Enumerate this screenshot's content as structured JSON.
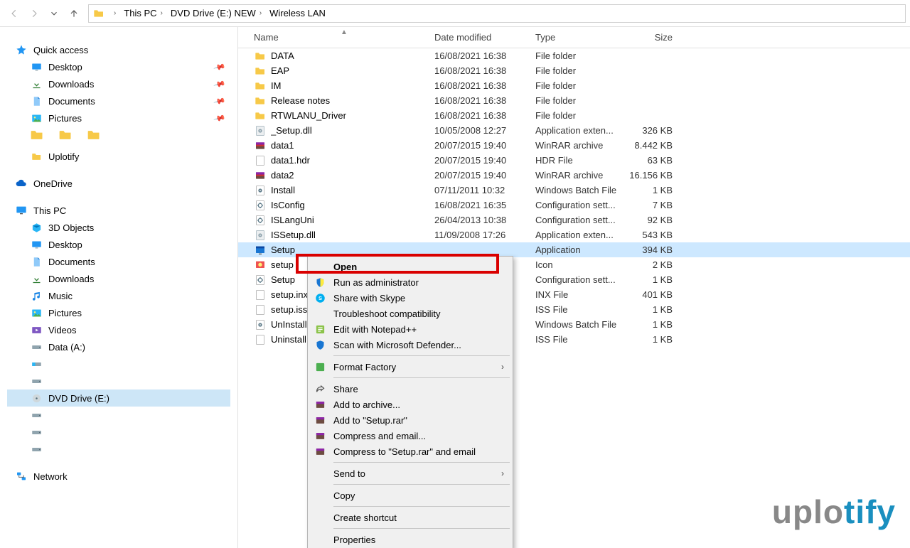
{
  "toolbar": {
    "breadcrumb": [
      "This PC",
      "DVD Drive (E:) NEW",
      "Wireless LAN"
    ]
  },
  "columns": {
    "name": "Name",
    "date": "Date modified",
    "type": "Type",
    "size": "Size"
  },
  "sidebar": {
    "quick_access": "Quick access",
    "desktop": "Desktop",
    "downloads": "Downloads",
    "documents": "Documents",
    "pictures": "Pictures",
    "uplotify": "Uplotify",
    "onedrive": "OneDrive",
    "this_pc": "This PC",
    "objects3d": "3D Objects",
    "desktop2": "Desktop",
    "documents2": "Documents",
    "downloads2": "Downloads",
    "music": "Music",
    "pictures2": "Pictures",
    "videos": "Videos",
    "data_a": "Data (A:)",
    "dvd_drive": "DVD Drive (E:)",
    "network": "Network"
  },
  "files": [
    {
      "icon": "folder",
      "name": "DATA",
      "date": "16/08/2021 16:38",
      "type": "File folder",
      "size": ""
    },
    {
      "icon": "folder",
      "name": "EAP",
      "date": "16/08/2021 16:38",
      "type": "File folder",
      "size": ""
    },
    {
      "icon": "folder",
      "name": "IM",
      "date": "16/08/2021 16:38",
      "type": "File folder",
      "size": ""
    },
    {
      "icon": "folder",
      "name": "Release notes",
      "date": "16/08/2021 16:38",
      "type": "File folder",
      "size": ""
    },
    {
      "icon": "folder",
      "name": "RTWLANU_Driver",
      "date": "16/08/2021 16:38",
      "type": "File folder",
      "size": ""
    },
    {
      "icon": "dll",
      "name": "_Setup.dll",
      "date": "10/05/2008 12:27",
      "type": "Application exten...",
      "size": "326 KB"
    },
    {
      "icon": "rar",
      "name": "data1",
      "date": "20/07/2015 19:40",
      "type": "WinRAR archive",
      "size": "8.442 KB"
    },
    {
      "icon": "hdr",
      "name": "data1.hdr",
      "date": "20/07/2015 19:40",
      "type": "HDR File",
      "size": "63 KB"
    },
    {
      "icon": "rar",
      "name": "data2",
      "date": "20/07/2015 19:40",
      "type": "WinRAR archive",
      "size": "16.156 KB"
    },
    {
      "icon": "bat",
      "name": "Install",
      "date": "07/11/2011 10:32",
      "type": "Windows Batch File",
      "size": "1 KB"
    },
    {
      "icon": "cfg",
      "name": "IsConfig",
      "date": "16/08/2021 16:35",
      "type": "Configuration sett...",
      "size": "7 KB"
    },
    {
      "icon": "cfg",
      "name": "ISLangUni",
      "date": "26/04/2013 10:38",
      "type": "Configuration sett...",
      "size": "92 KB"
    },
    {
      "icon": "dll",
      "name": "ISSetup.dll",
      "date": "11/09/2008 17:26",
      "type": "Application exten...",
      "size": "543 KB"
    },
    {
      "icon": "exe",
      "name": "Setup",
      "date": "",
      "type": "Application",
      "size": "394 KB",
      "selected": true
    },
    {
      "icon": "ico",
      "name": "setup",
      "date": "",
      "type": "Icon",
      "size": "2 KB"
    },
    {
      "icon": "cfg",
      "name": "Setup",
      "date": "",
      "type": "Configuration sett...",
      "size": "1 KB"
    },
    {
      "icon": "file",
      "name": "setup.inx",
      "date": "",
      "type": "INX File",
      "size": "401 KB"
    },
    {
      "icon": "file",
      "name": "setup.iss",
      "date": "",
      "type": "ISS File",
      "size": "1 KB"
    },
    {
      "icon": "bat",
      "name": "UnInstall",
      "date": "",
      "type": "Windows Batch File",
      "size": "1 KB"
    },
    {
      "icon": "file",
      "name": "Uninstall.iss",
      "date": "",
      "type": "ISS File",
      "size": "1 KB"
    }
  ],
  "context_menu": {
    "open": "Open",
    "run_as_admin": "Run as administrator",
    "share_skype": "Share with Skype",
    "troubleshoot": "Troubleshoot compatibility",
    "edit_notepadpp": "Edit with Notepad++",
    "scan_defender": "Scan with Microsoft Defender...",
    "format_factory": "Format Factory",
    "share": "Share",
    "add_archive": "Add to archive...",
    "add_setup_rar": "Add to \"Setup.rar\"",
    "compress_email": "Compress and email...",
    "compress_setup_rar_email": "Compress to \"Setup.rar\" and email",
    "send_to": "Send to",
    "copy": "Copy",
    "create_shortcut": "Create shortcut",
    "properties": "Properties"
  },
  "watermark": {
    "a": "uplo",
    "b": "tify"
  }
}
